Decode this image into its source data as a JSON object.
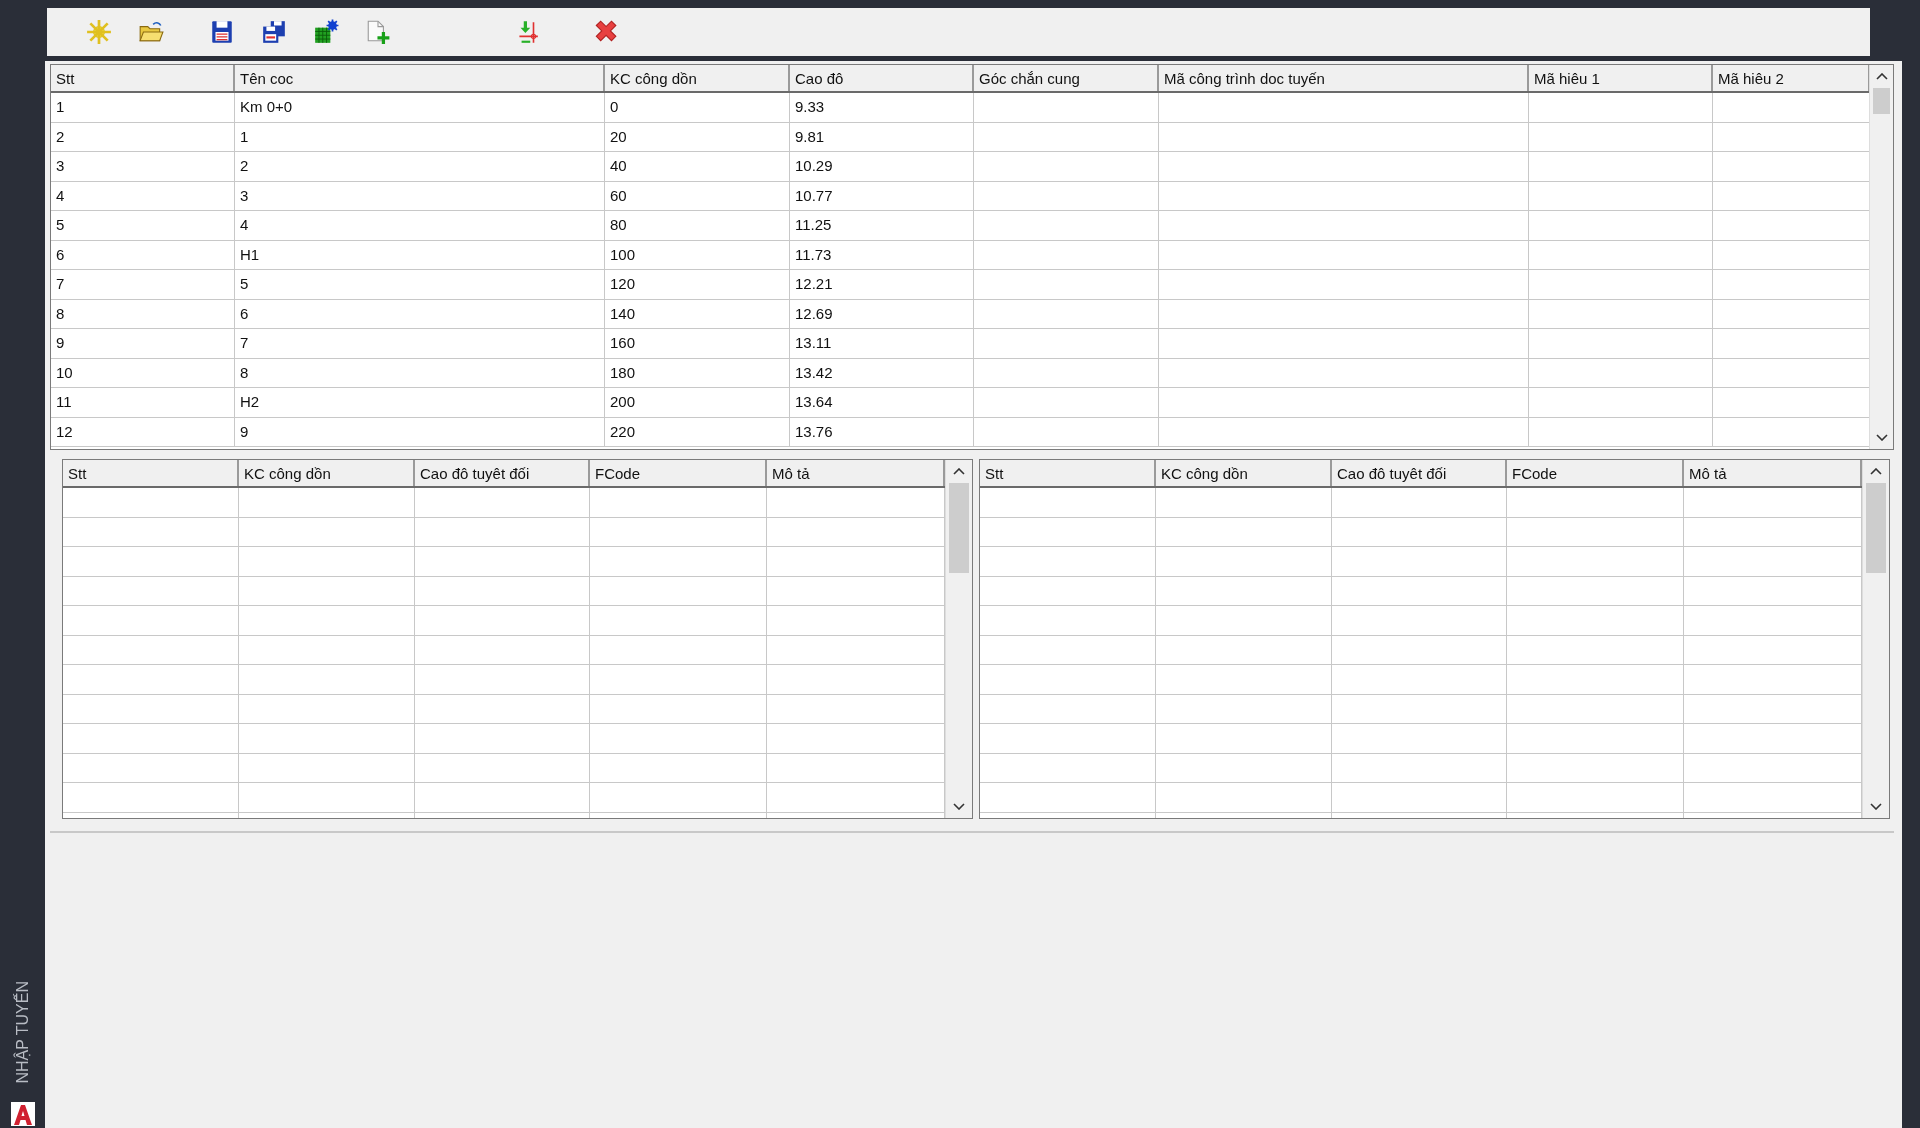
{
  "side_panel": {
    "title": "NHẬP TUYẾN"
  },
  "toolbar": {
    "groups": [
      [
        {
          "kind": "new"
        },
        {
          "kind": "open"
        }
      ],
      [
        {
          "kind": "save"
        },
        {
          "kind": "save-all"
        },
        {
          "kind": "grid-settings"
        },
        {
          "kind": "add-file"
        }
      ],
      [
        {
          "kind": "import"
        }
      ],
      [
        {
          "kind": "delete"
        }
      ]
    ]
  },
  "route_table": {
    "columns": [
      "Stt",
      "Tên coc",
      "KC công dồn",
      "Cao đô",
      "Góc chắn cung",
      "Mã công trình doc tuyến",
      "Mã hiêu 1",
      "Mã hiêu 2"
    ],
    "rows": [
      [
        "1",
        "Km 0+0",
        "0",
        "9.33"
      ],
      [
        "2",
        "1",
        "20",
        "9.81"
      ],
      [
        "3",
        "2",
        "40",
        "10.29"
      ],
      [
        "4",
        "3",
        "60",
        "10.77"
      ],
      [
        "5",
        "4",
        "80",
        "11.25"
      ],
      [
        "6",
        "H1",
        "100",
        "11.73"
      ],
      [
        "7",
        "5",
        "120",
        "12.21"
      ],
      [
        "8",
        "6",
        "140",
        "12.69"
      ],
      [
        "9",
        "7",
        "160",
        "13.11"
      ],
      [
        "10",
        "8",
        "180",
        "13.42"
      ],
      [
        "11",
        "H2",
        "200",
        "13.64"
      ],
      [
        "12",
        "9",
        "220",
        "13.76"
      ]
    ]
  },
  "left_table": {
    "columns": [
      "Stt",
      "KC công dồn",
      "Cao đô tuyêt đối",
      "FCode",
      "Mô tả"
    ]
  },
  "right_table": {
    "columns": [
      "Stt",
      "KC công dồn",
      "Cao đô tuyêt đối",
      "FCode",
      "Mô tả"
    ]
  }
}
